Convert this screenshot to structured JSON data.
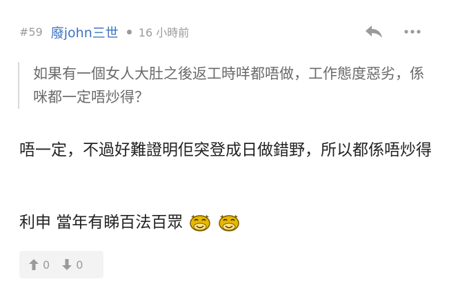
{
  "post": {
    "floor": "#59",
    "username": "廢john三世",
    "time": "16 小時前",
    "quote": "如果有一個女人大肚之後返工時咩都唔做，工作態度惡劣，係咪都一定唔炒得？",
    "body": "唔一定，不過好難證明佢突登成日做錯野，所以都係唔炒得",
    "body2": "利申 當年有睇百法百眾",
    "emoticons": [
      "monkey-laugh-emoticon",
      "monkey-laugh-emoticon"
    ],
    "votes": {
      "up": "0",
      "down": "0"
    }
  },
  "icons": {
    "reply": "reply-arrow-icon",
    "more": "more-dots-icon",
    "upvote": "thumb-arrow-up-icon",
    "downvote": "thumb-arrow-down-icon"
  },
  "colors": {
    "username": "#3c73c0",
    "muted": "#9a9a9a",
    "quote_text": "#6a6a6a",
    "quote_border": "#d8d8d8",
    "vote_bg": "#f3f3f3"
  }
}
